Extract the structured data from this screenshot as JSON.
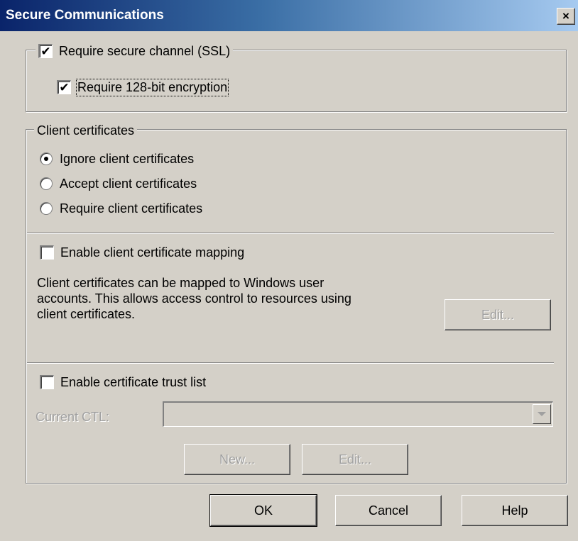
{
  "window": {
    "title": "Secure Communications",
    "close_glyph": "×"
  },
  "ssl": {
    "require_secure_channel": {
      "label": "Require secure channel (SSL)",
      "checked": true
    },
    "require_128bit": {
      "label": "Require 128-bit encryption",
      "checked": true
    }
  },
  "client_certificates": {
    "legend": "Client certificates",
    "options": [
      {
        "label": "Ignore client certificates",
        "selected": true
      },
      {
        "label": "Accept client certificates",
        "selected": false
      },
      {
        "label": "Require client certificates",
        "selected": false
      }
    ]
  },
  "mapping": {
    "enable_label": "Enable client certificate mapping",
    "checked": false,
    "description": "Client certificates can be mapped to Windows user\naccounts.  This allows access control to resources using\nclient certificates.",
    "edit_button": "Edit..."
  },
  "ctl": {
    "enable_label": "Enable certificate trust list",
    "checked": false,
    "current_ctl_label": "Current CTL:",
    "current_ctl_value": "",
    "new_button": "New...",
    "edit_button": "Edit..."
  },
  "buttons": {
    "ok": "OK",
    "cancel": "Cancel",
    "help": "Help"
  },
  "colors": {
    "face": "#d4d0c8",
    "title_start": "#0a246a",
    "title_end": "#a6caf0",
    "disabled_text": "#a0a0a0"
  }
}
